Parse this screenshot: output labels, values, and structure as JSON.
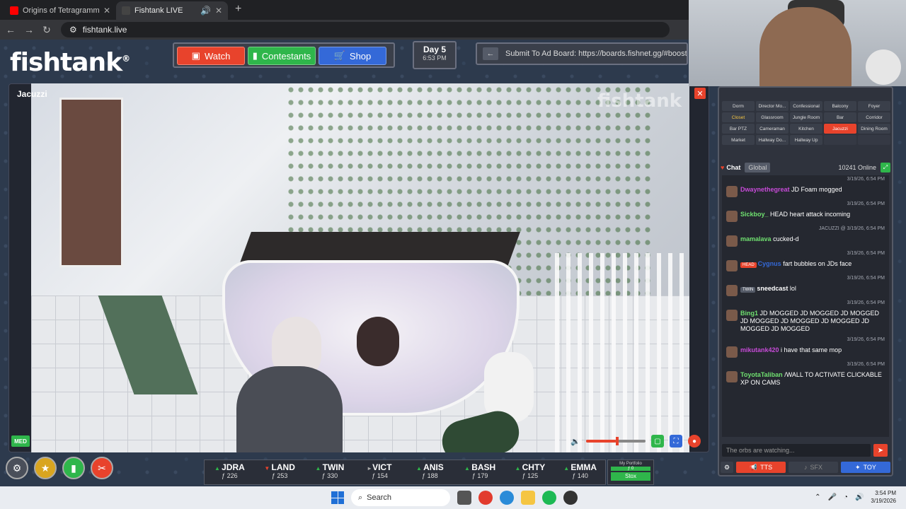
{
  "browser": {
    "tabs": [
      {
        "title": "Origins of Tetragrammaton | Jo",
        "active": false,
        "color": "#ff0000"
      },
      {
        "title": "Fishtank LIVE",
        "active": true,
        "color": "#444444"
      }
    ],
    "url": "fishtank.live"
  },
  "logo": {
    "text": "fishtank",
    "mark": "®"
  },
  "nav": {
    "watch": "Watch",
    "contestants": "Contestants",
    "shop": "Shop"
  },
  "day": {
    "label": "Day 5",
    "time": "6:53 PM"
  },
  "adboard": {
    "text": "Submit To Ad Board: https://boards.fishnet.gg/#boost"
  },
  "camera": {
    "label": "Jacuzzi",
    "watermark": "fishtank",
    "quality": "MED",
    "volume": 0.5
  },
  "rooms": [
    {
      "label": "Dorm",
      "state": "normal"
    },
    {
      "label": "Director Mo...",
      "state": "normal"
    },
    {
      "label": "Confessional",
      "state": "normal"
    },
    {
      "label": "Balcony",
      "state": "normal"
    },
    {
      "label": "Foyer",
      "state": "normal"
    },
    {
      "label": "Closet",
      "state": "highlight"
    },
    {
      "label": "Glassroom",
      "state": "normal"
    },
    {
      "label": "Jungle Room",
      "state": "normal"
    },
    {
      "label": "Bar",
      "state": "normal"
    },
    {
      "label": "Corridor",
      "state": "normal"
    },
    {
      "label": "Bar PTZ",
      "state": "normal"
    },
    {
      "label": "Cameraman",
      "state": "normal"
    },
    {
      "label": "Kitchen",
      "state": "normal"
    },
    {
      "label": "Jacuzzi",
      "state": "active"
    },
    {
      "label": "Dining Room",
      "state": "normal"
    },
    {
      "label": "Market",
      "state": "normal"
    },
    {
      "label": "Hallway Do...",
      "state": "normal"
    },
    {
      "label": "Hallway Up",
      "state": "normal"
    },
    {
      "label": "",
      "state": "empty"
    },
    {
      "label": "",
      "state": "empty"
    }
  ],
  "chat": {
    "title": "Chat",
    "global": "Global",
    "online": "10241 Online",
    "input_placeholder": "The orbs are watching...",
    "messages": [
      {
        "ts": "3/19/26, 6:54 PM",
        "name": "Dwaynethegreat",
        "color": "#c74bd8",
        "tag": "",
        "text": "JD Foam mogged"
      },
      {
        "ts": "3/19/26, 6:54 PM",
        "name": "Sickboy_",
        "color": "#6fe06f",
        "tag": "",
        "text": "HEAD heart attack incoming"
      },
      {
        "ts": "JACUZZI @ 3/19/26, 6:54 PM",
        "name": "mamalava",
        "color": "#6fe06f",
        "tag": "",
        "text": "cucked-d"
      },
      {
        "ts": "3/19/26, 6:54 PM",
        "name": "Cygnus",
        "color": "#3469d8",
        "tag": "HEAD",
        "tagColor": "#e8432c",
        "text": "fart bubbles on JDs face"
      },
      {
        "ts": "3/19/26, 6:54 PM",
        "name": "sneedcast",
        "color": "#ffffff",
        "tag": "TWIN",
        "tagColor": "#555b68",
        "text": "lol"
      },
      {
        "ts": "3/19/26, 6:54 PM",
        "name": "Bing1",
        "color": "#6fe06f",
        "tag": "",
        "text": "JD MOGGED JD MOGGED JD MOGGED JD MOGGED JD MOGGED JD MOGGED JD MOGGED JD MOGGED"
      },
      {
        "ts": "3/19/26, 6:54 PM",
        "name": "mikutank420",
        "color": "#c74bd8",
        "tag": "",
        "text": "i have that same mop"
      },
      {
        "ts": "3/19/26, 6:54 PM",
        "name": "ToyotaTaliban",
        "color": "#6fe06f",
        "tag": "",
        "text": "/WALL TO ACTIVATE CLICKABLE XP ON CAMS"
      }
    ],
    "buttons": {
      "tts": "TTS",
      "sfx": "SFX",
      "toy": "TOY"
    }
  },
  "ticker": [
    {
      "name": "JDRA",
      "price": "ƒ 226",
      "dir": "up"
    },
    {
      "name": "LAND",
      "price": "ƒ 253",
      "dir": "down"
    },
    {
      "name": "TWIN",
      "price": "ƒ 330",
      "dir": "up"
    },
    {
      "name": "VICT",
      "price": "ƒ 154",
      "dir": "flat"
    },
    {
      "name": "ANIS",
      "price": "ƒ 188",
      "dir": "up"
    },
    {
      "name": "BASH",
      "price": "ƒ 179",
      "dir": "up"
    },
    {
      "name": "CHTY",
      "price": "ƒ 125",
      "dir": "up"
    },
    {
      "name": "EMMA",
      "price": "ƒ 140",
      "dir": "up"
    }
  ],
  "portfolio": {
    "label": "My Portfolio",
    "value": "ƒ 0",
    "button": "Stox"
  },
  "taskbar": {
    "search": "Search",
    "time": "3:54 PM",
    "date": "3/19/2026"
  },
  "colors": {
    "red": "#e8432c",
    "green": "#2fb64b",
    "blue": "#3469d8"
  }
}
